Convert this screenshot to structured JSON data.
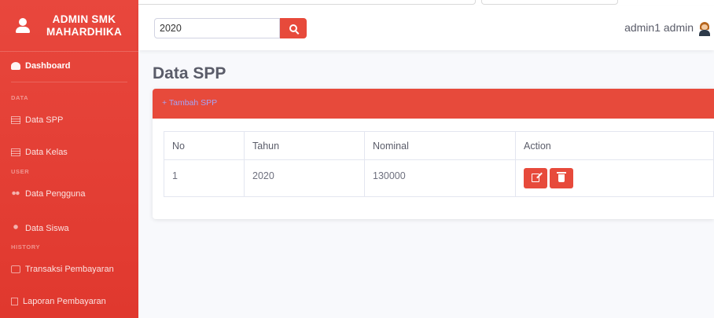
{
  "sidebar": {
    "brand": "ADMIN SMK MAHARDHIKA",
    "items": [
      {
        "label": "Dashboard",
        "icon": "dashboard-icon"
      },
      {
        "label": "Data SPP",
        "icon": "table-icon"
      },
      {
        "label": "Data Kelas",
        "icon": "table-icon"
      },
      {
        "label": "Data Pengguna",
        "icon": "users-icon"
      },
      {
        "label": "Data Siswa",
        "icon": "user-icon"
      },
      {
        "label": "Transaksi Pembayaran",
        "icon": "money-icon"
      },
      {
        "label": "Laporan Pembayaran",
        "icon": "file-icon"
      }
    ],
    "headings": [
      "DATA",
      "USER",
      "HISTORY"
    ]
  },
  "topbar": {
    "search_value": "2020",
    "username": "admin1 admin"
  },
  "main": {
    "page_title": "Data SPP",
    "add_link": "+ Tambah SPP",
    "table": {
      "headers": [
        "No",
        "Tahun",
        "Nominal",
        "Action"
      ],
      "rows": [
        {
          "no": "1",
          "tahun": "2020",
          "nominal": "130000"
        }
      ]
    }
  },
  "colors": {
    "accent": "#e74a3b",
    "link": "#a7a4f5"
  }
}
